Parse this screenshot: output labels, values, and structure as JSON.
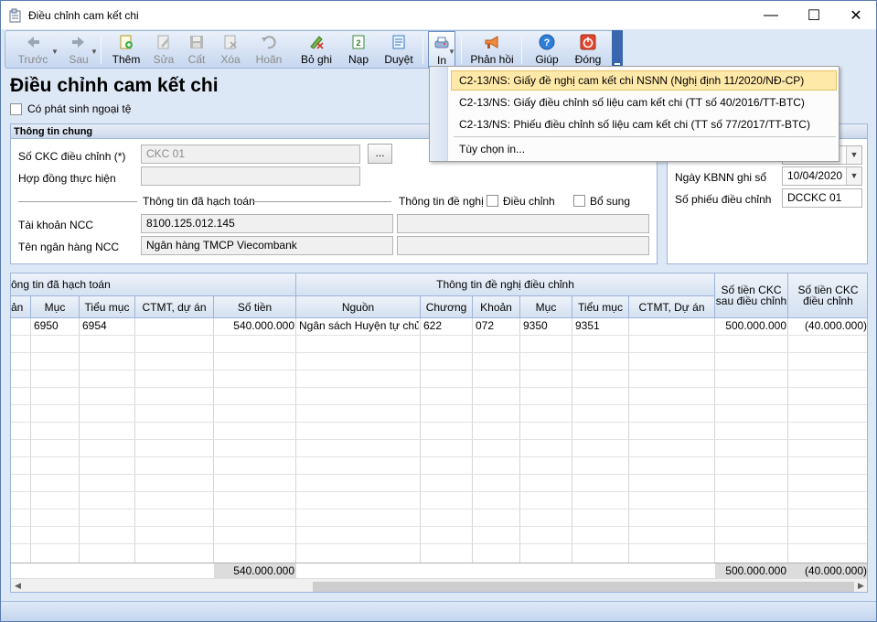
{
  "window": {
    "title": "Điều chỉnh cam kết chi",
    "minimize": "—",
    "maximize": "☐",
    "close": "✕"
  },
  "toolbar": {
    "prev": "Trước",
    "next": "Sau",
    "add": "Thêm",
    "edit": "Sửa",
    "save": "Cất",
    "delete": "Xóa",
    "undo": "Hoãn",
    "unpost": "Bỏ ghi",
    "load": "Nạp",
    "approve": "Duyệt",
    "print": "In",
    "feedback": "Phản hồi",
    "help": "Giúp",
    "close": "Đóng"
  },
  "page": {
    "title": "Điều chỉnh cam kết chi",
    "foreign_currency_label": "Có phát sinh ngoại tệ"
  },
  "general": {
    "heading": "Thông tin chung",
    "ckc_label": "Số CKC điều chỉnh (*)",
    "ckc_value": "CKC 01",
    "browse": "...",
    "contract_label": "Hợp đồng thực hiện",
    "contract_value": "",
    "posted_heading": "Thông tin đã hạch toán",
    "proposal_heading": "Thông tin đề nghị",
    "adjust_label": "Điều chỉnh",
    "supplement_label": "Bổ sung",
    "account_label": "Tài khoản NCC",
    "account_value": "8100.125.012.145",
    "account_proposal": "",
    "bank_label": "Tên ngân hàng NCC",
    "bank_value": "Ngân hàng TMCP Viecombank",
    "bank_proposal": ""
  },
  "right_panel": {
    "top_select_value": "",
    "kbnn_label": "Ngày KBNN ghi sổ",
    "kbnn_value": "10/04/2020",
    "voucher_label": "Số phiếu điều chỉnh",
    "voucher_value": "DCCKC 01"
  },
  "grid": {
    "group_posted": "ông tin đã hạch toán",
    "group_proposal": "Thông tin đề nghị điều chỉnh",
    "col_after": "Số tiền CKC sau điều chỉnh",
    "col_adjust": "Số tiền CKC điều chỉnh",
    "headers": [
      "ản",
      "Mục",
      "Tiểu mục",
      "CTMT, dự án",
      "Số tiền",
      "Nguồn",
      "Chương",
      "Khoản",
      "Mục",
      "Tiểu mục",
      "CTMT, Dự án"
    ],
    "rows": [
      {
        "c0": "",
        "muc": "6950",
        "tieu_muc": "6954",
        "ctmt": "",
        "so_tien": "540.000.000",
        "nguon": "Ngân sách Huyện tự chủ",
        "chuong": "622",
        "khoan": "072",
        "muc2": "9350",
        "tieu_muc2": "9351",
        "ctmt2": "",
        "sau_dc": "500.000.000",
        "dieu_chinh": "(40.000.000)"
      }
    ],
    "totals": {
      "so_tien": "540.000.000",
      "sau_dc": "500.000.000",
      "dieu_chinh": "(40.000.000)"
    }
  },
  "print_menu": {
    "items": [
      "C2-13/NS: Giấy đề nghị cam kết chi NSNN  (Nghị định 11/2020/NĐ-CP)",
      "C2-13/NS: Giấy điều chỉnh số liệu cam kết chi (TT số 40/2016/TT-BTC)",
      "C2-13/NS: Phiếu điều chỉnh số liệu cam kết chi (TT số 77/2017/TT-BTC)",
      "Tùy chọn in..."
    ]
  },
  "colors": {
    "accent": "#3a66b0",
    "menu_highlight": "#ffe9a8"
  }
}
